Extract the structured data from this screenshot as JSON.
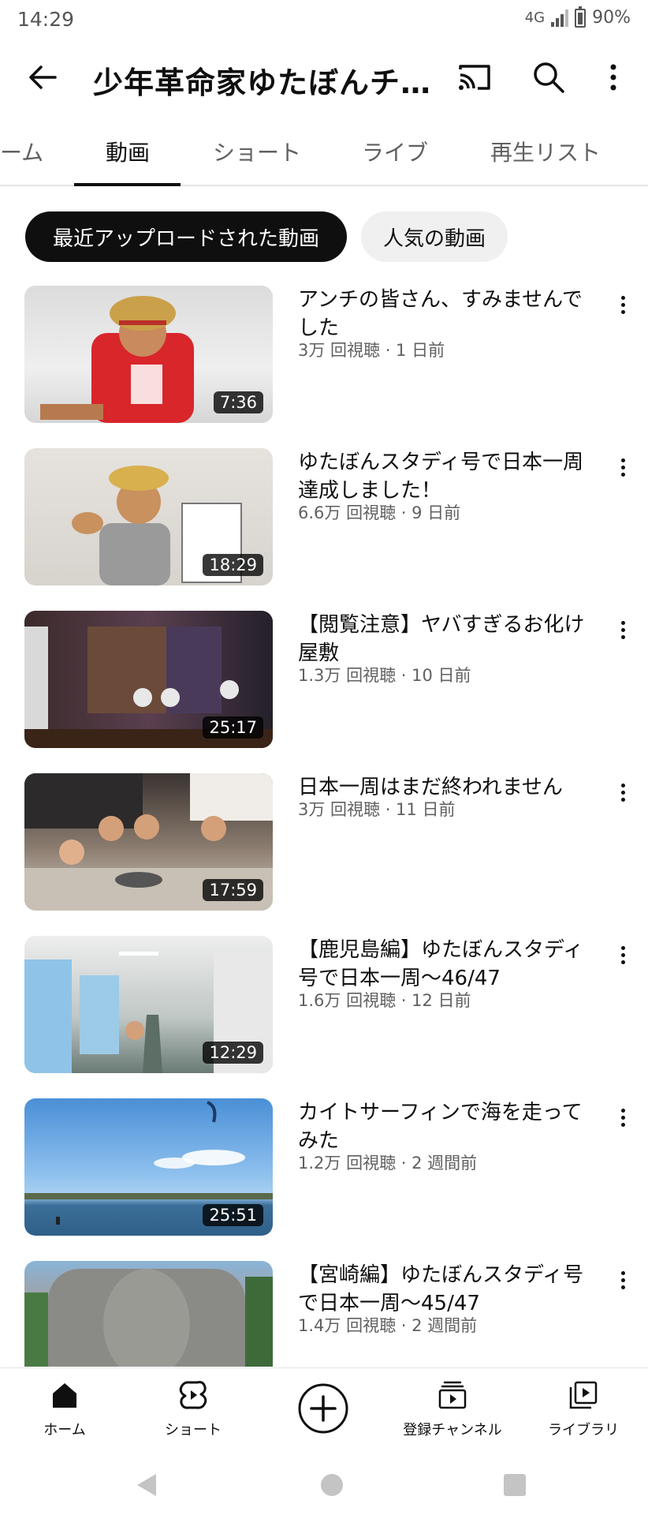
{
  "status": {
    "time": "14:29",
    "network": "4G",
    "battery": "90%"
  },
  "header": {
    "channel_title": "少年革命家ゆたぼんチ…"
  },
  "tabs": [
    {
      "label": "ーム"
    },
    {
      "label": "動画"
    },
    {
      "label": "ショート"
    },
    {
      "label": "ライブ"
    },
    {
      "label": "再生リスト"
    }
  ],
  "chips": {
    "recent": "最近アップロードされた動画",
    "popular": "人気の動画"
  },
  "videos": [
    {
      "title": "アンチの皆さん、すみませんでした",
      "meta": "3万 回視聴 · 1 日前",
      "duration": "7:36"
    },
    {
      "title": "ゆたぼんスタディ号で日本一周達成しました！",
      "meta": "6.6万 回視聴 · 9 日前",
      "duration": "18:29"
    },
    {
      "title": "【閲覧注意】ヤバすぎるお化け屋敷",
      "meta": "1.3万 回視聴 · 10 日前",
      "duration": "25:17"
    },
    {
      "title": "日本一周はまだ終われません",
      "meta": "3万 回視聴 · 11 日前",
      "duration": "17:59"
    },
    {
      "title": "【鹿児島編】ゆたぼんスタディ号で日本一周〜46/47",
      "meta": "1.6万 回視聴 · 12 日前",
      "duration": "12:29"
    },
    {
      "title": "カイトサーフィンで海を走ってみた",
      "meta": "1.2万 回視聴 · 2 週間前",
      "duration": "25:51"
    },
    {
      "title": "【宮崎編】ゆたぼんスタディ号で日本一周〜45/47",
      "meta": "1.4万 回視聴 · 2 週間前",
      "duration": ""
    }
  ],
  "bottom_nav": {
    "home": "ホーム",
    "shorts": "ショート",
    "subscriptions": "登録チャンネル",
    "library": "ライブラリ"
  }
}
